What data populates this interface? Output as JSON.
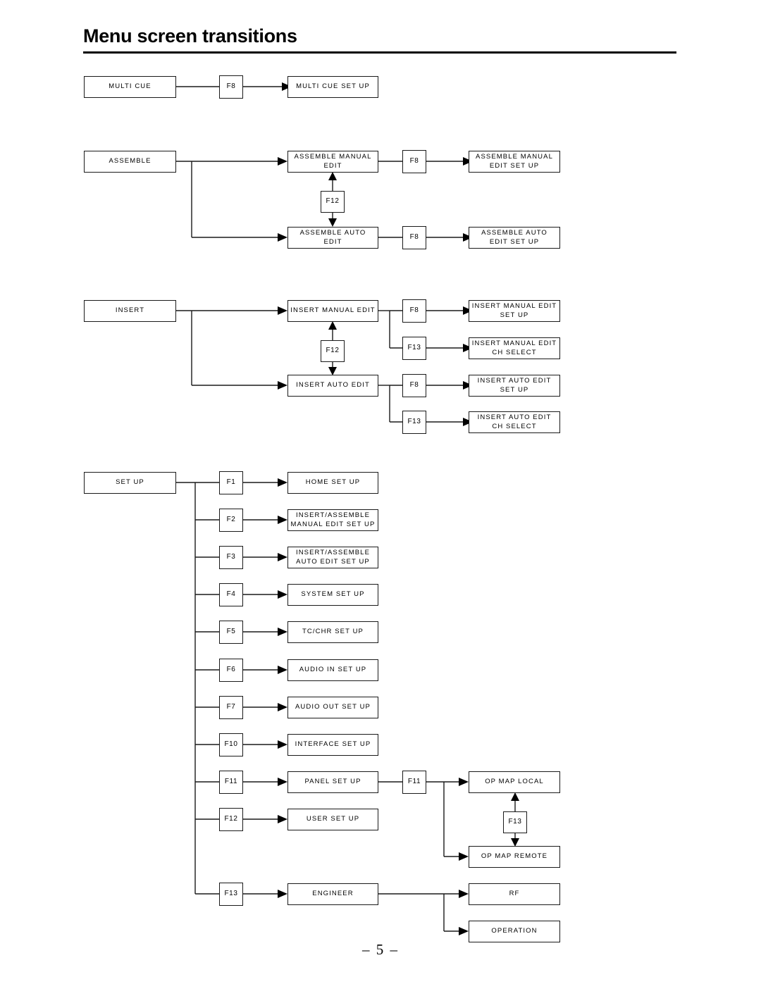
{
  "header": {
    "title": "Menu screen transitions"
  },
  "footer": {
    "page_number": "– 5 –"
  },
  "diagram": {
    "type": "flowchart",
    "description": "Menu screen transition map showing root menus, function-key transitions and resulting set-up screens",
    "groups": [
      {
        "name": "multi-cue",
        "root": "MULTI CUE",
        "branches": [
          {
            "key": "F8",
            "target": "MULTI CUE SET UP"
          }
        ]
      },
      {
        "name": "assemble",
        "root": "ASSEMBLE",
        "branches": [
          {
            "key": "",
            "target": "ASSEMBLE MANUAL EDIT",
            "sub": [
              {
                "key": "F8",
                "target": "ASSEMBLE MANUAL EDIT SET UP"
              }
            ]
          },
          {
            "key": "",
            "target": "ASSEMBLE AUTO EDIT",
            "sub": [
              {
                "key": "F8",
                "target": "ASSEMBLE AUTO EDIT SET UP"
              }
            ]
          }
        ],
        "toggle": {
          "key": "F12",
          "between": [
            "ASSEMBLE MANUAL EDIT",
            "ASSEMBLE AUTO EDIT"
          ]
        }
      },
      {
        "name": "insert",
        "root": "INSERT",
        "branches": [
          {
            "key": "",
            "target": "INSERT MANUAL EDIT",
            "sub": [
              {
                "key": "F8",
                "target": "INSERT MANUAL EDIT SET UP"
              },
              {
                "key": "F13",
                "target": "INSERT MANUAL EDIT CH SELECT"
              }
            ]
          },
          {
            "key": "",
            "target": "INSERT AUTO EDIT",
            "sub": [
              {
                "key": "F8",
                "target": "INSERT AUTO EDIT SET UP"
              },
              {
                "key": "F13",
                "target": "INSERT AUTO EDIT CH SELECT"
              }
            ]
          }
        ],
        "toggle": {
          "key": "F12",
          "between": [
            "INSERT MANUAL EDIT",
            "INSERT AUTO EDIT"
          ]
        }
      },
      {
        "name": "set-up",
        "root": "SET UP",
        "branches": [
          {
            "key": "F1",
            "target": "HOME SET UP"
          },
          {
            "key": "F2",
            "target": "INSERT/ASSEMBLE MANUAL EDIT SET UP"
          },
          {
            "key": "F3",
            "target": "INSERT/ASSEMBLE AUTO EDIT SET UP"
          },
          {
            "key": "F4",
            "target": "SYSTEM SET UP"
          },
          {
            "key": "F5",
            "target": "TC/CHR SET UP"
          },
          {
            "key": "F6",
            "target": "AUDIO IN SET UP"
          },
          {
            "key": "F7",
            "target": "AUDIO OUT SET UP"
          },
          {
            "key": "F10",
            "target": "INTERFACE SET UP"
          },
          {
            "key": "F11",
            "target": "PANEL SET UP",
            "sub": [
              {
                "key": "F11",
                "target": "OP MAP LOCAL"
              },
              {
                "key": "F11",
                "target": "OP MAP REMOTE"
              }
            ]
          },
          {
            "key": "F12",
            "target": "USER SET UP"
          },
          {
            "key": "F13",
            "target": "ENGINEER",
            "sub": [
              {
                "key": "",
                "target": "RF"
              },
              {
                "key": "",
                "target": "OPERATION"
              }
            ]
          }
        ],
        "toggle": {
          "key": "F13",
          "between": [
            "OP MAP LOCAL",
            "OP MAP REMOTE"
          ]
        }
      }
    ],
    "nodes": {
      "multi_cue": "MULTI CUE",
      "multi_cue_key": "F8",
      "multi_cue_setup": "MULTI CUE SET UP",
      "assemble": "ASSEMBLE",
      "assemble_manual_edit": "ASSEMBLE MANUAL EDIT",
      "assemble_manual_key": "F8",
      "assemble_manual_setup": "ASSEMBLE MANUAL EDIT SET UP",
      "assemble_toggle_key": "F12",
      "assemble_auto_edit": "ASSEMBLE AUTO EDIT",
      "assemble_auto_key": "F8",
      "assemble_auto_setup": "ASSEMBLE AUTO EDIT SET UP",
      "insert": "INSERT",
      "insert_manual_edit": "INSERT MANUAL EDIT",
      "insert_manual_key_f8": "F8",
      "insert_manual_setup": "INSERT MANUAL EDIT SET UP",
      "insert_manual_key_f13": "F13",
      "insert_manual_ch_select": "INSERT MANUAL EDIT CH SELECT",
      "insert_toggle_key": "F12",
      "insert_auto_edit": "INSERT AUTO EDIT",
      "insert_auto_key_f8": "F8",
      "insert_auto_setup": "INSERT AUTO EDIT SET UP",
      "insert_auto_key_f13": "F13",
      "insert_auto_ch_select": "INSERT AUTO EDIT CH SELECT",
      "set_up": "SET UP",
      "key_f1": "F1",
      "home_set_up": "HOME SET UP",
      "key_f2": "F2",
      "insert_assemble_manual_setup": "INSERT/ASSEMBLE MANUAL EDIT SET UP",
      "key_f3": "F3",
      "insert_assemble_auto_setup": "INSERT/ASSEMBLE AUTO EDIT SET UP",
      "key_f4": "F4",
      "system_set_up": "SYSTEM SET UP",
      "key_f5": "F5",
      "tc_chr_set_up": "TC/CHR SET UP",
      "key_f6": "F6",
      "audio_in_set_up": "AUDIO IN SET UP",
      "key_f7": "F7",
      "audio_out_set_up": "AUDIO OUT SET UP",
      "key_f10": "F10",
      "interface_set_up": "INTERFACE SET UP",
      "key_f11": "F11",
      "panel_set_up": "PANEL SET UP",
      "panel_key_f11": "F11",
      "op_map_local": "OP MAP LOCAL",
      "op_map_toggle_key": "F13",
      "op_map_remote": "OP MAP REMOTE",
      "key_f12": "F12",
      "user_set_up": "USER SET UP",
      "key_f13": "F13",
      "engineer": "ENGINEER",
      "rf": "RF",
      "operation": "OPERATION"
    }
  }
}
